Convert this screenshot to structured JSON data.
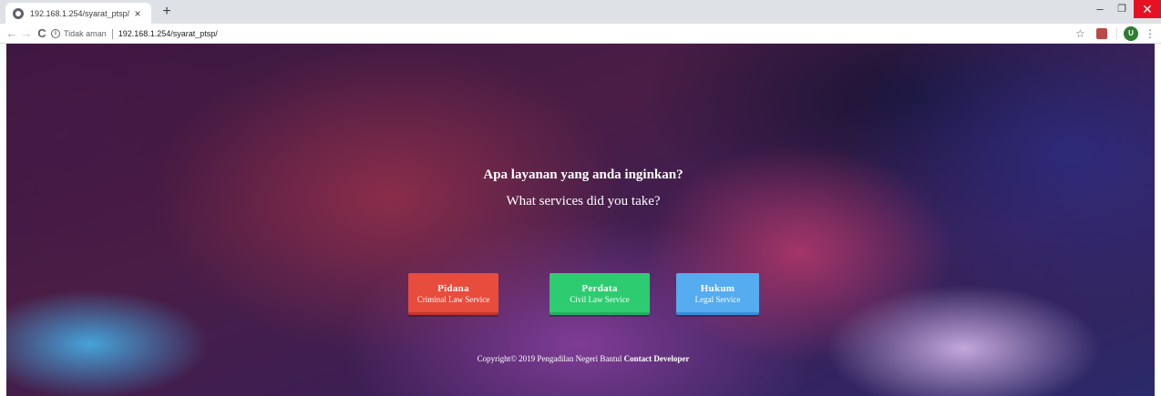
{
  "browser": {
    "tab_title": "192.168.1.254/syarat_ptsp/",
    "tab_close": "×",
    "new_tab": "+",
    "security_label": "Tidak aman",
    "url": "192.168.1.254/syarat_ptsp/",
    "profile_initial": "U",
    "window_controls": {
      "minimize": "–",
      "maximize": "❐",
      "close": "✕"
    },
    "icons": [
      "favicon-icon",
      "back-icon",
      "forward-icon",
      "reload-icon",
      "info-icon",
      "star-icon",
      "extension-icon",
      "profile-icon",
      "menu-icon"
    ]
  },
  "page": {
    "heading": "Apa layanan yang anda inginkan?",
    "subheading": "What services did you take?",
    "services": [
      {
        "title": "Pidana",
        "subtitle": "Criminal Law Service",
        "color": "#e74c3c"
      },
      {
        "title": "Perdata",
        "subtitle": "Civil Law Service",
        "color": "#2ecc71"
      },
      {
        "title": "Hukum",
        "subtitle": "Legal Service",
        "color": "#55acee"
      }
    ],
    "footer": {
      "copyright": "Copyright© 2019 Pengadilan Negeri Bantul",
      "link": "Contact Developer"
    }
  }
}
